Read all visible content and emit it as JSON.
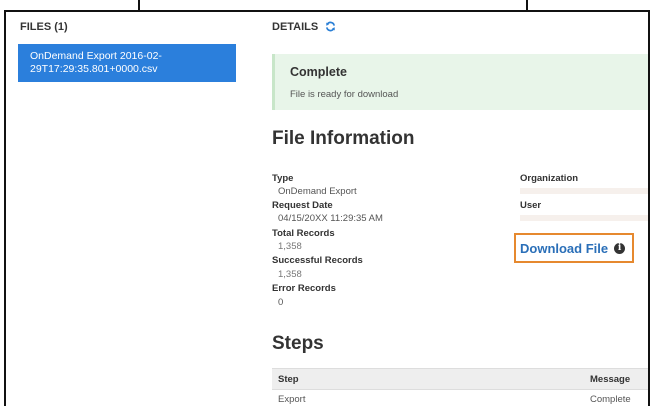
{
  "files_panel": {
    "title": "FILES (1)",
    "items": [
      {
        "label": "OnDemand Export 2016-02-29T17:29:35.801+0000.csv"
      }
    ]
  },
  "details": {
    "title": "DETAILS",
    "refresh_icon": "refresh-icon",
    "status": {
      "title": "Complete",
      "message": "File is ready for download",
      "color": "#e8f5e9"
    },
    "file_info_title": "File Information",
    "fields": {
      "type_label": "Type",
      "type_value": "OnDemand Export",
      "request_date_label": "Request Date",
      "request_date_value": "04/15/20XX 11:29:35 AM",
      "total_records_label": "Total Records",
      "total_records_value": "1,358",
      "successful_records_label": "Successful Records",
      "successful_records_value": "1,358",
      "error_records_label": "Error Records",
      "error_records_value": "0",
      "organization_label": "Organization",
      "user_label": "User"
    },
    "download_label": "Download File",
    "download_icon": "info-icon",
    "accent_color": "#2a6fb8",
    "highlight_color": "#e6892f",
    "steps_title": "Steps",
    "steps_table": {
      "headers": [
        "Step",
        "Message"
      ],
      "rows": [
        [
          "Export",
          "Complete"
        ]
      ]
    }
  }
}
